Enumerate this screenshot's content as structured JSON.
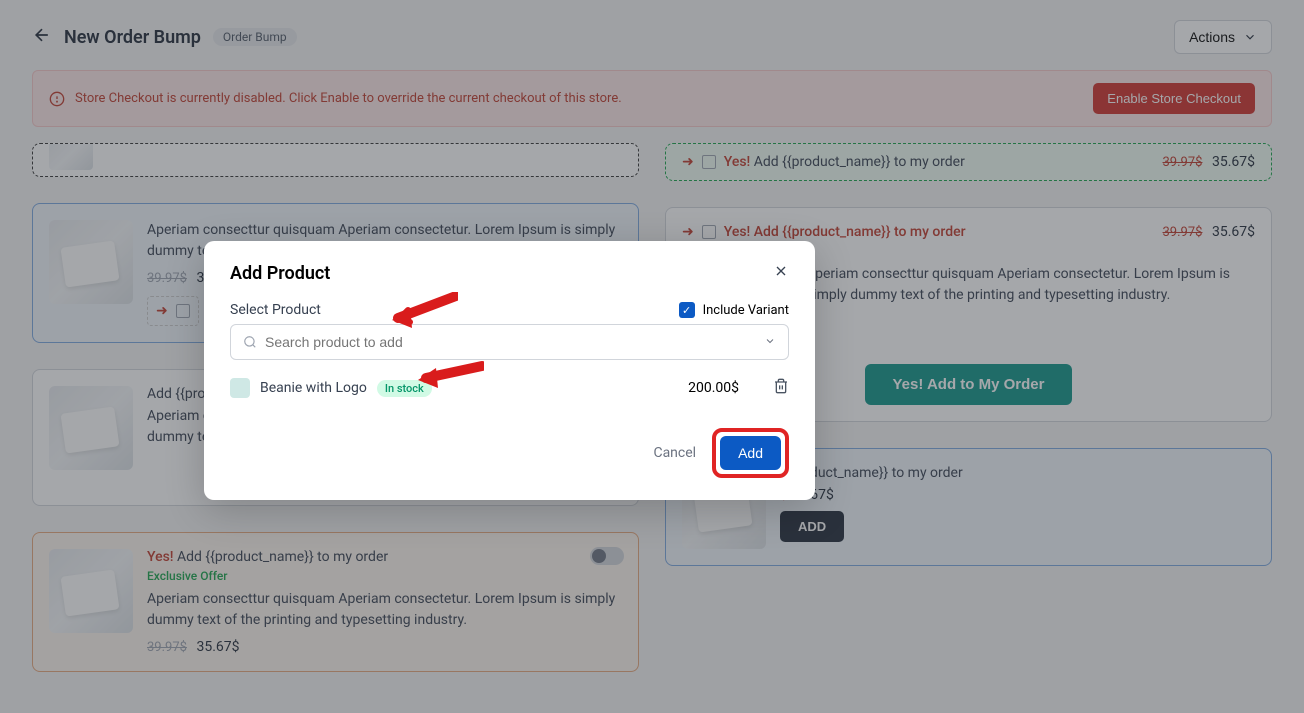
{
  "header": {
    "title": "New Order Bump",
    "badge": "Order Bump",
    "actions_label": "Actions"
  },
  "alert": {
    "message": "Store Checkout is currently disabled. Click Enable to override the current checkout of this store.",
    "button": "Enable Store Checkout"
  },
  "cards": {
    "lorem": "Aperiam consecttur quisquam Aperiam consectetur. Lorem Ipsum is simply dummy text of the printing and typesetting industry.",
    "lorem_short": "Aperiam consecttur quisquam Aperiam consectetur. Lorem Ipsum is simply dummy text of the printing and typesetting industry.",
    "price_old": "39.97$",
    "price_new": "35.67$",
    "yes_prefix": "Yes!",
    "yes_suffix": "Add {{product_name}} to my order",
    "add_line": "Add {{product_name}} to my order",
    "exclusive": "Exclusive Offer",
    "add_btn": "ADD",
    "green_btn": "Yes! Add to My Order"
  },
  "modal": {
    "title": "Add Product",
    "select_label": "Select Product",
    "include_variant": "Include Variant",
    "search_placeholder": "Search product to add",
    "product_name": "Beanie with Logo",
    "stock": "In stock",
    "price": "200.00$",
    "cancel": "Cancel",
    "add": "Add"
  }
}
